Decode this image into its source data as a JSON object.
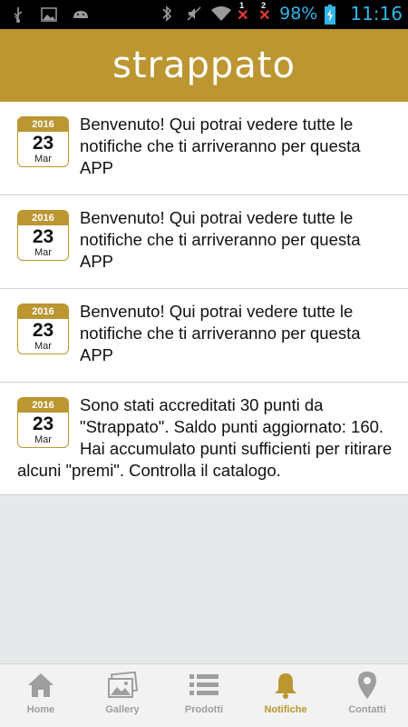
{
  "status_bar": {
    "battery": "98%",
    "time": "11:16",
    "sim1": "1",
    "sim2": "2",
    "color": "#33b5e5"
  },
  "header": {
    "logo_text": "strappato",
    "color": "#bb9631"
  },
  "notifications": [
    {
      "year": "2016",
      "day": "23",
      "month": "Mar",
      "message": "Benvenuto! Qui potrai vedere tutte le notifiche che ti arriveranno per questa APP"
    },
    {
      "year": "2016",
      "day": "23",
      "month": "Mar",
      "message": "Benvenuto! Qui potrai vedere tutte le notifiche che ti arriveranno per questa APP"
    },
    {
      "year": "2016",
      "day": "23",
      "month": "Mar",
      "message": "Benvenuto! Qui potrai vedere tutte le notifiche che ti arriveranno per questa APP"
    },
    {
      "year": "2016",
      "day": "23",
      "month": "Mar",
      "message": "Sono stati accreditati 30 punti da \"Strappato\". Saldo punti aggiornato: 160. Hai accumulato punti sufficienti per ritirare alcuni \"premi\". Controlla il catalogo."
    }
  ],
  "bottom_nav": {
    "items": [
      {
        "label": "Home",
        "icon": "home-icon"
      },
      {
        "label": "Gallery",
        "icon": "gallery-icon"
      },
      {
        "label": "Prodotti",
        "icon": "list-icon"
      },
      {
        "label": "Notifiche",
        "icon": "bell-icon"
      },
      {
        "label": "Contatti",
        "icon": "location-pin-icon"
      }
    ],
    "active": "Notifiche",
    "active_color": "#bb9631",
    "inactive_color": "#9e9e9e"
  }
}
